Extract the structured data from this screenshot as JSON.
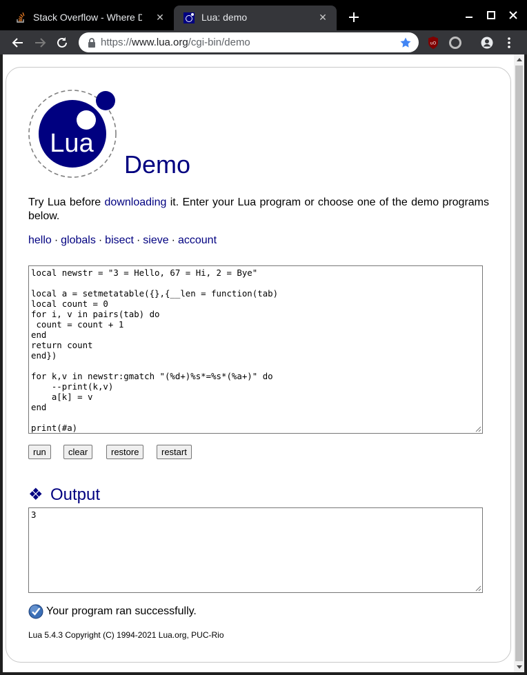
{
  "browser": {
    "tabs": [
      {
        "title": "Stack Overflow - Where De",
        "favicon": "stackoverflow-icon",
        "active": false
      },
      {
        "title": "Lua: demo",
        "favicon": "lua-icon",
        "active": true
      }
    ],
    "url_scheme": "https://",
    "url_host": "www.lua.org",
    "url_path": "/cgi-bin/demo"
  },
  "page": {
    "title": "Demo",
    "logo_text": "Lua",
    "intro_before": "Try Lua before ",
    "intro_link": "downloading",
    "intro_after": " it. Enter your Lua program or choose one of the demo programs below.",
    "demos": [
      "hello",
      "globals",
      "bisect",
      "sieve",
      "account"
    ],
    "demo_separator": "·",
    "code": "local newstr = \"3 = Hello, 67 = Hi, 2 = Bye\"\n\nlocal a = setmetatable({},{__len = function(tab)\nlocal count = 0\nfor i, v in pairs(tab) do\n count = count + 1\nend\nreturn count\nend})\n\nfor k,v in newstr:gmatch \"(%d+)%s*=%s*(%a+)\" do\n    --print(k,v)\n    a[k] = v\nend\n\nprint(#a)",
    "buttons": {
      "run": "run",
      "clear": "clear",
      "restore": "restore",
      "restart": "restart"
    },
    "output_title": "Output",
    "output_bullet": "❖",
    "output_text": "3",
    "status_text": "Your program ran successfully.",
    "footer": "Lua 5.4.3 Copyright (C) 1994-2021 Lua.org, PUC-Rio"
  },
  "colors": {
    "link": "#000080",
    "lua_blue": "#000080",
    "chrome_dark": "#000000",
    "chrome_toolbar": "#35363a",
    "star_blue": "#4285f4"
  }
}
